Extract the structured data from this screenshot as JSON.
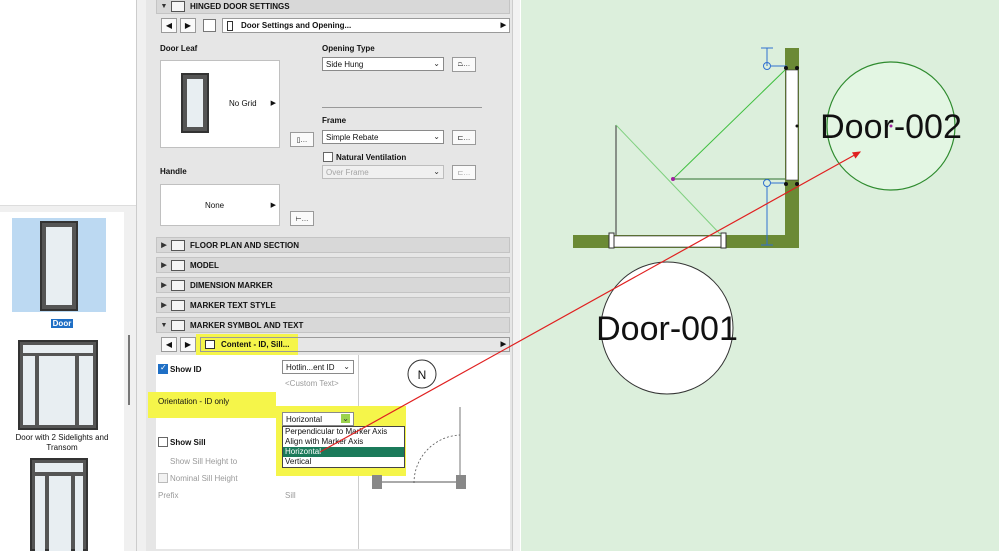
{
  "library": {
    "items": [
      {
        "label": "Door",
        "selected": true
      },
      {
        "label": "Door with 2 Sidelights and Transom",
        "selected": false
      },
      {
        "label": "",
        "selected": false
      }
    ]
  },
  "panel": {
    "hinged_door_title": "HINGED DOOR SETTINGS",
    "path_label": "Door Settings and Opening...",
    "door_leaf": {
      "label": "Door Leaf",
      "value": "No Grid"
    },
    "handle": {
      "label": "Handle",
      "value": "None"
    },
    "opening_type": {
      "label": "Opening Type",
      "value": "Side Hung"
    },
    "frame": {
      "label": "Frame",
      "value": "Simple Rebate"
    },
    "natural_ventilation": {
      "label": "Natural Ventilation",
      "checked": false,
      "value": "Over Frame"
    },
    "sections": [
      {
        "label": "FLOOR PLAN AND SECTION",
        "expanded": false
      },
      {
        "label": "MODEL",
        "expanded": false
      },
      {
        "label": "DIMENSION MARKER",
        "expanded": false
      },
      {
        "label": "MARKER TEXT STYLE",
        "expanded": false
      },
      {
        "label": "MARKER SYMBOL AND TEXT",
        "expanded": true
      }
    ],
    "marker_path": "Content - ID, Sill...",
    "show_id": {
      "label": "Show ID",
      "checked": true,
      "value": "Hotlin...ent ID",
      "custom_text": "<Custom Text>"
    },
    "orientation": {
      "label": "Orientation - ID only",
      "value": "Horizontal",
      "options": [
        "Perpendicular to Marker Axis",
        "Align with Marker Axis",
        "Horizontal",
        "Vertical"
      ],
      "selected_index": 2
    },
    "show_sill": {
      "label": "Show Sill",
      "checked": false
    },
    "show_sill_height": {
      "label": "Show Sill Height to"
    },
    "nominal_sill_height": {
      "label": "Nominal Sill Height",
      "checked": false
    },
    "prefix": {
      "label": "Prefix",
      "value": "Sill"
    },
    "north_label": "N"
  },
  "canvas": {
    "tags": [
      "Door-002",
      "Door-001"
    ]
  },
  "colors": {
    "highlight": "#f5f54a",
    "wall": "#6b8a35",
    "arrow": "#e02020",
    "canvas_bg": "#dcefdc",
    "selection_blue": "#bcd9f2"
  }
}
